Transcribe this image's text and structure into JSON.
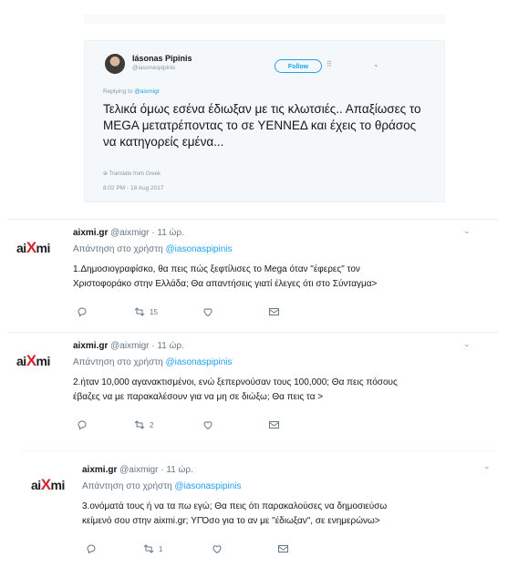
{
  "quoted_tweet": {
    "author_name": "Iásonas Pipinis",
    "author_handle": "@iasonaspipinis",
    "follow_label": "Follow",
    "follow_extra": "⠿",
    "menu_caret": "⌄",
    "replying_prefix": "Replying to ",
    "replying_mention": "@aixmigr",
    "text": "Τελικά όμως εσένα έδιωξαν με τις κλωτσιές.. Απαξίωσες το MEGA μετατρέποντας το σε ΥΕΝΝΕΔ και έχεις το θράσος να κατηγορείς εμένα...",
    "translate_label": "⊕ Translate from Greek",
    "timestamp": "8:02 PM - 18 Aug 2017"
  },
  "replies": [
    {
      "logo_a": "ai",
      "logo_x": "X",
      "logo_b": "mi",
      "display_name": "aixmi.gr",
      "handle_time": " @aixmigr · 11 ώρ.",
      "reply_prefix": "Απάντηση στο χρήστη ",
      "reply_mention": "@iasonaspipinis",
      "line1": "1.Δημοσιογραφίσκο, θα πεις πώς ξεφτίλισες το Mega όταν \"έφερες\" τον",
      "line2": "Χριστοφοράκο στην Ελλάδα; Θα απαντήσεις γιατί έλεγες ότι στο Σύνταγμα>",
      "retweet_count": "15",
      "caret": "⌄"
    },
    {
      "logo_a": "ai",
      "logo_x": "X",
      "logo_b": "mi",
      "display_name": "aixmi.gr",
      "handle_time": " @aixmigr · 11 ώρ.",
      "reply_prefix": "Απάντηση στο χρήστη ",
      "reply_mention": "@iasonaspipinis",
      "line1": "2.ήταν 10,000 αγανακτισμένοι, ενώ ξεπερνούσαν τους 100,000; Θα πεις πόσους",
      "line2": "έβαζες να με παρακαλέσουν για να μη σε διώξω; Θα πεις τα >",
      "retweet_count": "2",
      "caret": "⌄"
    },
    {
      "logo_a": "ai",
      "logo_x": "X",
      "logo_b": "mi",
      "display_name": "aixmi.gr",
      "handle_time": " @aixmigr · 11 ώρ.",
      "reply_prefix": "Απάντηση στο χρήστη ",
      "reply_mention": "@iasonaspipinis",
      "line1": "3.ονόματά τους ή να τα πω εγώ; Θα πεις ότι παρακαλούσες να δημοσιεύσω",
      "line2": "κείμενό σου στην aixmi.gr; ΥΓΌσο για το αν με \"έδιωξαν\", σε ενημερώνω>",
      "retweet_count": "1",
      "caret": "⌄"
    }
  ]
}
